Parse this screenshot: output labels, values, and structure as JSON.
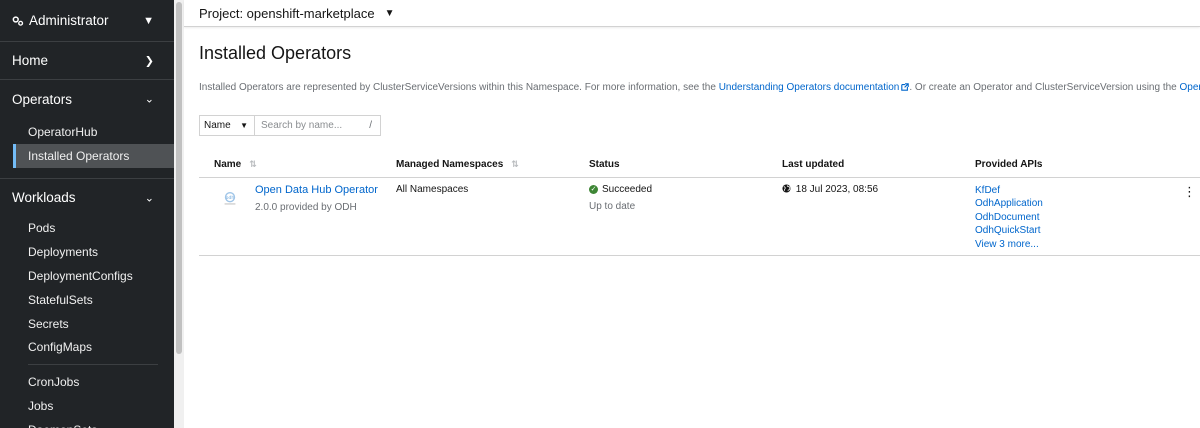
{
  "sidebar": {
    "perspective": "Administrator",
    "home": "Home",
    "operators": {
      "label": "Operators",
      "items": [
        "OperatorHub",
        "Installed Operators"
      ]
    },
    "workloads": {
      "label": "Workloads",
      "items": [
        "Pods",
        "Deployments",
        "DeploymentConfigs",
        "StatefulSets",
        "Secrets",
        "ConfigMaps",
        "CronJobs",
        "Jobs",
        "DaemonSets"
      ]
    }
  },
  "topbar": {
    "project": "Project: openshift-marketplace"
  },
  "page": {
    "title": "Installed Operators",
    "desc_pre": "Installed Operators are represented by ClusterServiceVersions within this Namespace. For more information, see the ",
    "desc_link1": "Understanding Operators documentation",
    "desc_mid": ". Or create an Operator and ClusterServiceVersion using the ",
    "desc_link2": "Operator SDK",
    "desc_post": "."
  },
  "filter": {
    "type": "Name",
    "placeholder": "Search by name...",
    "shortcut": "/"
  },
  "table": {
    "headers": [
      "Name",
      "Managed Namespaces",
      "Status",
      "Last updated",
      "Provided APIs"
    ],
    "rows": [
      {
        "name": "Open Data Hub Operator",
        "sub": "2.0.0 provided by ODH",
        "namespaces": "All Namespaces",
        "status": "Succeeded",
        "status_sub": "Up to date",
        "updated": "18 Jul 2023, 08:56",
        "apis": [
          "KfDef",
          "OdhApplication",
          "OdhDocument",
          "OdhQuickStart"
        ],
        "more": "View 3 more..."
      }
    ]
  },
  "colors": {
    "link": "#0066cc",
    "success": "#3e8635",
    "sidebar_bg": "#212427",
    "active_border": "#73bcf7"
  }
}
